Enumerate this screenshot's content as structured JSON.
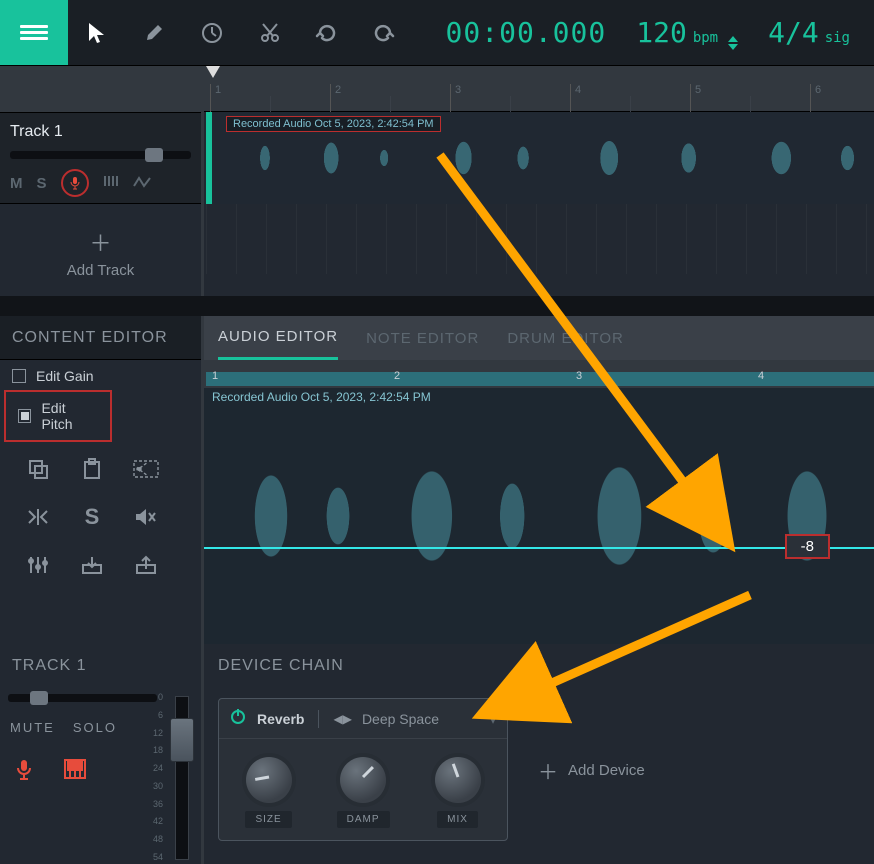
{
  "topbar": {
    "time": "00:00.000",
    "bpm_value": "120",
    "bpm_label": "bpm",
    "sig_value": "4/4",
    "sig_label": "sig"
  },
  "track": {
    "name": "Track 1",
    "mute": "M",
    "solo": "S",
    "add_track": "Add Track"
  },
  "arrangement": {
    "clip_label": "Recorded Audio Oct 5, 2023, 2:42:54 PM",
    "ticks": [
      "1",
      "2",
      "3",
      "4",
      "5",
      "6"
    ]
  },
  "content_editor": {
    "title": "CONTENT EDITOR",
    "edit_gain": "Edit Gain",
    "edit_pitch": "Edit Pitch"
  },
  "editor_tabs": {
    "audio": "AUDIO EDITOR",
    "note": "NOTE EDITOR",
    "drum": "DRUM EDITOR"
  },
  "audio_editor": {
    "clip_label": "Recorded Audio Oct 5, 2023, 2:42:54 PM",
    "ruler_ticks": [
      "1",
      "2",
      "3",
      "4"
    ],
    "pitch_value": "-8"
  },
  "mixer": {
    "title": "TRACK 1",
    "mute": "MUTE",
    "solo": "SOLO",
    "scale": [
      "0",
      "6",
      "12",
      "18",
      "24",
      "30",
      "36",
      "42",
      "48",
      "54"
    ]
  },
  "device_chain": {
    "title": "DEVICE CHAIN",
    "device_name": "Reverb",
    "preset_name": "Deep Space",
    "knobs": [
      "SIZE",
      "DAMP",
      "MIX"
    ],
    "add_device": "Add Device"
  }
}
